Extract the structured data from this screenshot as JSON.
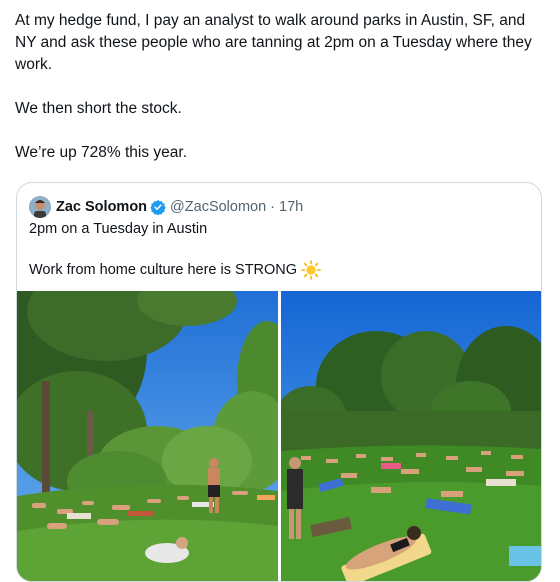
{
  "tweet": {
    "paragraphs": [
      "At my hedge fund, I pay an analyst to walk around parks in Austin, SF, and NY and ask these people who are tanning at 2pm on a Tuesday where they work.",
      "We then short the stock.",
      "We’re up 728% this year."
    ]
  },
  "quoted_tweet": {
    "author_name": "Zac Solomon",
    "handle": "@ZacSolomon",
    "separator": "·",
    "time": "17h",
    "line1": "2pm on a Tuesday in Austin",
    "line2": "Work from home culture here is STRONG",
    "emoji_icon": "sun-icon",
    "verified_icon": "verified-badge-icon",
    "colors": {
      "verified": "#1d9bf0",
      "handle": "#536471",
      "border": "#cfd9de"
    }
  },
  "media": [
    {
      "name": "park-photo-left"
    },
    {
      "name": "park-photo-right"
    }
  ]
}
